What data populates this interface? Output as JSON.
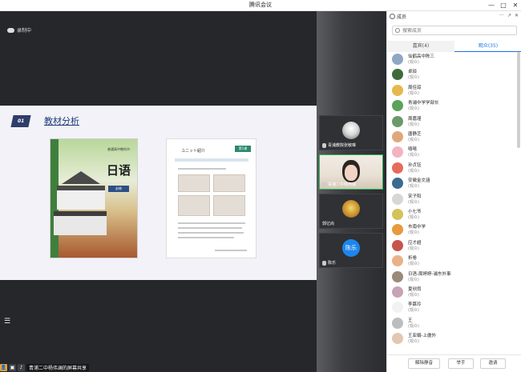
{
  "window": {
    "title": "腾讯会议",
    "min": "—",
    "max": "□",
    "close": "✕"
  },
  "stage": {
    "recording": "录制中",
    "share_label": "青浦二中杨伟澜的屏幕共享",
    "slide": {
      "num": "01",
      "heading": "教材分析"
    },
    "book": {
      "sub": "普通高中教科书",
      "jp": "日语",
      "grade": "必修"
    },
    "page": {
      "title": "ユニット紹介",
      "tag": "第1课"
    }
  },
  "thumbs": [
    {
      "label": "青浦教院张敏琳"
    },
    {
      "label": "青浦二中杨伟澜"
    },
    {
      "label": "郭亿尚"
    },
    {
      "label": "陈乐",
      "avatar_text": "陈乐"
    }
  ],
  "panel": {
    "title": "成员",
    "more": "···",
    "pin": "↗",
    "close": "✕",
    "search_placeholder": "搜索成员",
    "tab_host": "嘉宾(4)",
    "tab_audience": "观众(35)",
    "members": [
      {
        "name": "仙鹤高中陈三",
        "role": "(观众)",
        "color": "#8fa7c4"
      },
      {
        "name": "卓琰",
        "role": "(观众)",
        "color": "#3f6b3b"
      },
      {
        "name": "周佳琼",
        "role": "(观众)",
        "color": "#e6b84d"
      },
      {
        "name": "青浦中学学部长",
        "role": "(观众)",
        "color": "#5aa35a"
      },
      {
        "name": "周嘉瑾",
        "role": "(观众)",
        "color": "#6b9a6a"
      },
      {
        "name": "唐静芝",
        "role": "(观众)",
        "color": "#e0a87a"
      },
      {
        "name": "嘻嘻",
        "role": "(观众)",
        "color": "#f3b3c0"
      },
      {
        "name": "孙贞钰",
        "role": "(观众)",
        "color": "#e66b5b"
      },
      {
        "name": "安徽金文涵",
        "role": "(观众)",
        "color": "#3b6b8f"
      },
      {
        "name": "宋子阳",
        "role": "(观众)",
        "color": "#d7d7d7"
      },
      {
        "name": "小七爷",
        "role": "(观众)",
        "color": "#d4c25a"
      },
      {
        "name": "市南中学",
        "role": "(观众)",
        "color": "#e89a3c"
      },
      {
        "name": "应才超",
        "role": "(观众)",
        "color": "#c8554a"
      },
      {
        "name": "折卷",
        "role": "(观众)",
        "color": "#e9b28a"
      },
      {
        "name": "日语-周婷婷-浦东外事",
        "role": "(观众)",
        "color": "#9a8a7a"
      },
      {
        "name": "夏欣雨",
        "role": "(观众)",
        "color": "#c9a2b6"
      },
      {
        "name": "李慕玲",
        "role": "(观众)",
        "color": "#f2f2f2"
      },
      {
        "name": "王",
        "role": "(观众)",
        "color": "#bdbdbd"
      },
      {
        "name": "王亚娟-上虞外",
        "role": "(观众)",
        "color": "#e4c7b0"
      }
    ],
    "btn_mute_all": "解除静音",
    "btn_raise": "举手",
    "btn_invite": "邀请"
  }
}
